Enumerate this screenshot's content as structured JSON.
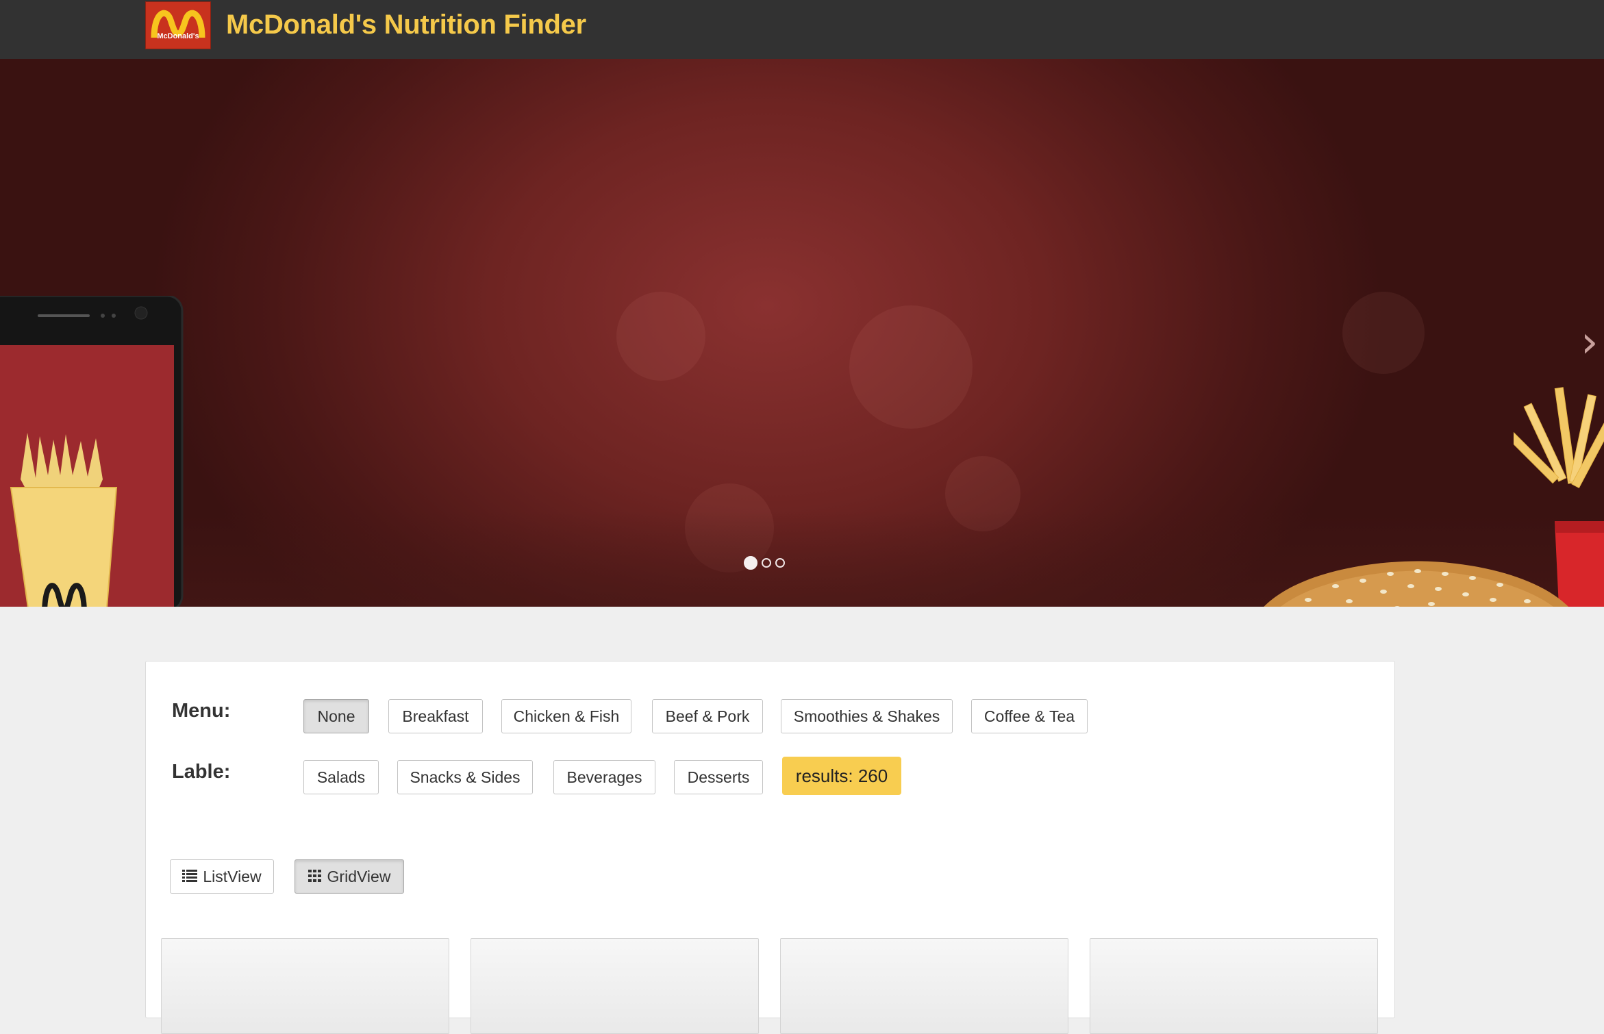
{
  "header": {
    "logo_text": "McDonald's",
    "title": "McDonald's Nutrition Finder"
  },
  "carousel": {
    "slide_count": 3,
    "active_slide": 1,
    "next_icon": "chevron-right-icon"
  },
  "filters": {
    "menu_label": "Menu:",
    "menu_options": [
      "None",
      "Breakfast",
      "Chicken & Fish",
      "Beef & Pork",
      "Smoothies & Shakes",
      "Coffee & Tea"
    ],
    "selected_menu": "None",
    "lable_label": "Lable:",
    "lable_options": [
      "Salads",
      "Snacks & Sides",
      "Beverages",
      "Desserts"
    ],
    "results_text": "results: 260"
  },
  "view_toggle": {
    "list_label": "ListView",
    "list_icon": "list-icon",
    "grid_label": "GridView",
    "grid_icon": "grid-icon",
    "selected": "GridView"
  },
  "colors": {
    "topbar": "#323232",
    "title": "#f5c94a",
    "hero": "#6e2422",
    "results_badge": "#f8cd50"
  }
}
